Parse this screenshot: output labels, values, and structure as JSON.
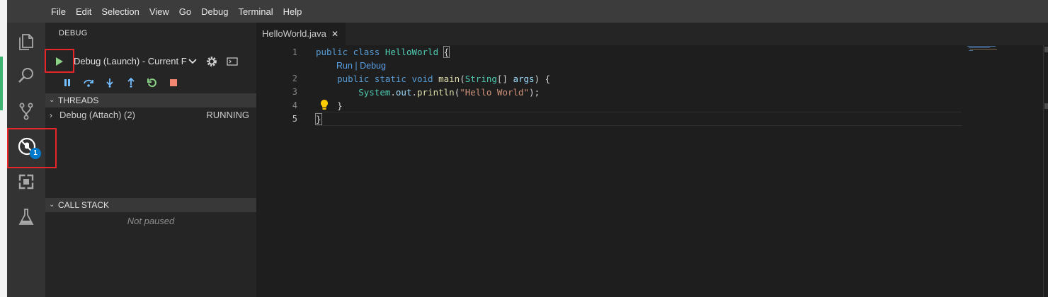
{
  "menu": [
    "File",
    "Edit",
    "Selection",
    "View",
    "Go",
    "Debug",
    "Terminal",
    "Help"
  ],
  "activity_bar": {
    "items": [
      "explorer-icon",
      "search-icon",
      "source-control-icon",
      "debug-icon",
      "extensions-icon",
      "test-icon"
    ],
    "active": "debug-icon",
    "debug_badge": "1"
  },
  "sidebar": {
    "title": "DEBUG",
    "configuration": "Debug (Launch) - Current F",
    "threads_header": "THREADS",
    "threads": [
      {
        "name": "Debug (Attach) (2)",
        "status": "RUNNING"
      }
    ],
    "call_stack_header": "CALL STACK",
    "call_stack_empty": "Not paused"
  },
  "editor": {
    "tab_label": "HelloWorld.java",
    "codelens": "Run | Debug",
    "line_numbers": [
      "1",
      "2",
      "3",
      "4",
      "5"
    ],
    "colors": {
      "keyword": "#569cd6",
      "class": "#4ec9b0",
      "function": "#dcdcaa",
      "parameter": "#9cdcfe",
      "string": "#ce9178"
    }
  },
  "highlight_color": "#e8262a"
}
